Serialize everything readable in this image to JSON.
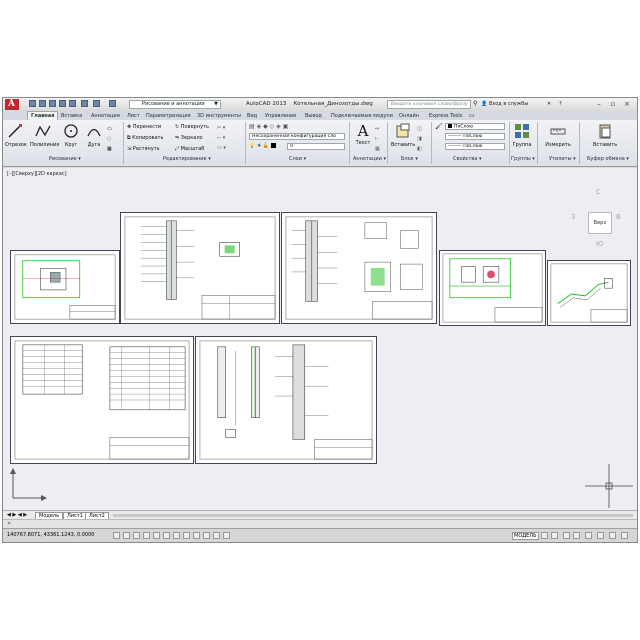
{
  "app": {
    "title": "AutoCAD 2013",
    "file": "Котельная_Динозотды.dwg",
    "logo_letter": "A",
    "workspace": "Рисование и аннотации",
    "search_placeholder": "Введите ключевое слово/фразу",
    "login": "Вход в службы"
  },
  "tabs": [
    {
      "label": "Главная",
      "active": true
    },
    {
      "label": "Вставка"
    },
    {
      "label": "Аннотации"
    },
    {
      "label": "Лист"
    },
    {
      "label": "Параметризация"
    },
    {
      "label": "3D инструменты"
    },
    {
      "label": "Вид"
    },
    {
      "label": "Управление"
    },
    {
      "label": "Вывод"
    },
    {
      "label": "Подключаемые модули"
    },
    {
      "label": "Онлайн"
    },
    {
      "label": "Express Tools"
    }
  ],
  "panels": {
    "draw": {
      "title": "Рисование",
      "tools": [
        "Отрезок",
        "Полилиния",
        "Круг",
        "Дуга"
      ]
    },
    "modify": {
      "title": "Редактирование",
      "tools": [
        "Перенести",
        "Повернуть",
        "Копировать",
        "Зеркало",
        "Растянуть",
        "Масштаб"
      ]
    },
    "layers": {
      "title": "Слои",
      "state": "Несохраненная конфигурация сло",
      "current": "0"
    },
    "annotation": {
      "title": "Аннотации",
      "text": "Текст"
    },
    "block": {
      "title": "Блок",
      "insert": "Вставить"
    },
    "properties": {
      "title": "Свойства",
      "color": "ПоСлою",
      "linetype": "ПоСлою",
      "lineweight": "ПоСлою"
    },
    "groups": {
      "title": "Группы",
      "group": "Группа"
    },
    "utilities": {
      "title": "Утилиты",
      "measure": "Измерить"
    },
    "clipboard": {
      "title": "Буфер обмена",
      "paste": "Вставить"
    }
  },
  "viewport": {
    "label": "[–][Сверху][2D каркас]",
    "viewcube": "Верх",
    "compass": {
      "n": "С",
      "s": "Ю",
      "w": "З",
      "e": "В"
    }
  },
  "layout_tabs": [
    "Модель",
    "Лист1",
    "Лист2"
  ],
  "status": {
    "coordinates": "140767.8071, 43361.1243, 0.0000",
    "model": "МОДЕЛЬ"
  },
  "colors": {
    "ribbon": "#e4e7ee",
    "canvas": "#efedf4",
    "logo": "#c0262d",
    "drawing_green": "#1cc21c"
  }
}
